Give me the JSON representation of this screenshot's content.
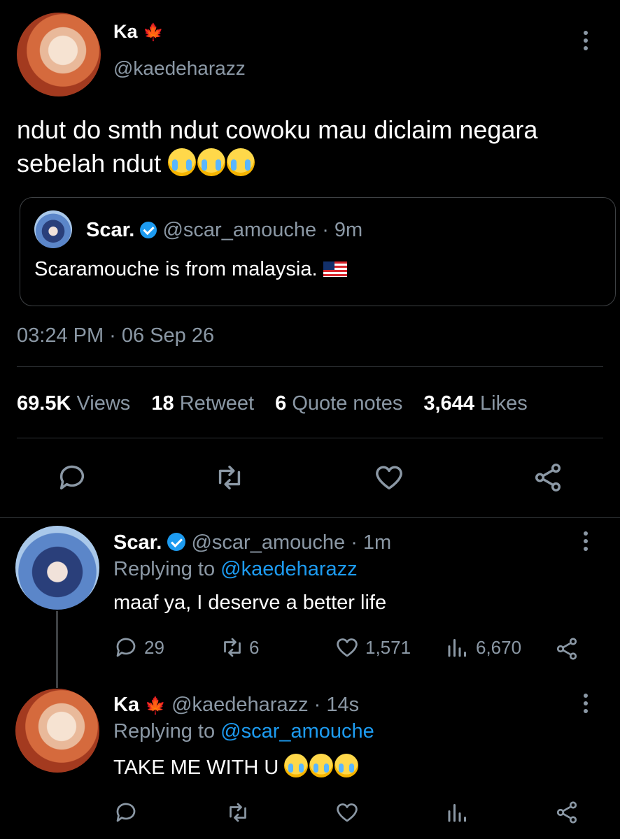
{
  "main_tweet": {
    "author_name": "Ka",
    "author_handle": "@kaedeharazz",
    "text": "ndut do smth ndut cowoku mau diclaim negara sebelah ndut",
    "timestamp": "03:24 PM · 06 Sep 26",
    "stats": {
      "views_count": "69.5K",
      "views_label": "Views",
      "retweet_count": "18",
      "retweet_label": "Retweet",
      "quote_count": "6",
      "quote_label": "Quote notes",
      "likes_count": "3,644",
      "likes_label": "Likes"
    }
  },
  "quoted_tweet": {
    "author_name": "Scar.",
    "author_handle": "@scar_amouche",
    "time": "· 9m",
    "text": "Scaramouche is from malaysia."
  },
  "replies": [
    {
      "author_name": "Scar.",
      "author_handle": "@scar_amouche",
      "time": "· 1m",
      "replying_prefix": "Replying to",
      "replying_to": "@kaedeharazz",
      "text": "maaf ya, I deserve a better life",
      "reply_count": "29",
      "retweet_count": "6",
      "like_count": "1,571",
      "view_count": "6,670"
    },
    {
      "author_name": "Ka",
      "author_handle": "@kaedeharazz",
      "time": "· 14s",
      "replying_prefix": "Replying to",
      "replying_to": "@scar_amouche",
      "text": "TAKE ME WITH U"
    }
  ],
  "colors": {
    "background": "#000000",
    "muted": "#8b98a5",
    "accent": "#1d9bf0",
    "divider": "#2f3336"
  }
}
